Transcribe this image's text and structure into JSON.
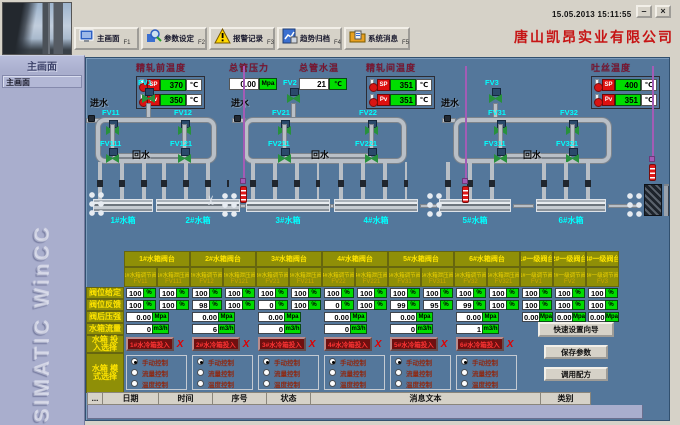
{
  "window": {
    "datetime": "15.05.2013 15:11:55",
    "company": "唐山凯昂实业有限公司",
    "minimize": "–",
    "close": "×"
  },
  "toolbar": {
    "buttons": [
      {
        "label": "主画面",
        "fkey": "F1"
      },
      {
        "label": "参数设定",
        "fkey": "F2"
      },
      {
        "label": "报警记录",
        "fkey": "F3"
      },
      {
        "label": "趋势归档",
        "fkey": "F4"
      },
      {
        "label": "系统消息",
        "fkey": "F5"
      }
    ]
  },
  "sidebar": {
    "title": "主画面",
    "nav_button": "主画面",
    "watermark": "SIMATIC WinCC"
  },
  "diagram": {
    "inlet_label": "进水",
    "return_label": "回水",
    "temp_panels": [
      {
        "title": "精轧前温度",
        "rows": [
          {
            "tag": "SP",
            "value": "370",
            "unit": "℃"
          },
          {
            "tag": "Pv",
            "value": "350",
            "unit": "℃"
          }
        ]
      },
      {
        "title": "总管压力",
        "rows": [
          {
            "value": "0.00",
            "unit": "Mpa"
          }
        ]
      },
      {
        "title": "总管水温",
        "rows": [
          {
            "value": "21",
            "unit": "℃"
          }
        ]
      },
      {
        "title": "精轧间温度",
        "rows": [
          {
            "tag": "SP",
            "value": "351",
            "unit": "℃"
          },
          {
            "tag": "Pv",
            "value": "351",
            "unit": "℃"
          }
        ]
      },
      {
        "title": "吐丝温度",
        "rows": [
          {
            "tag": "SP",
            "value": "400",
            "unit": "℃"
          },
          {
            "tag": "Pv",
            "value": "351",
            "unit": "℃"
          }
        ]
      }
    ],
    "sections": [
      {
        "main_valve": "FV1",
        "branch1": "FV11",
        "branch2": "FV12",
        "relief1": "FV111",
        "relief2": "FV121"
      },
      {
        "main_valve": "FV2",
        "branch1": "FV21",
        "branch2": "FV22",
        "relief1": "FV211",
        "relief2": "FV221"
      },
      {
        "main_valve": "FV3",
        "branch1": "FV31",
        "branch2": "FV32",
        "relief1": "FV311",
        "relief2": "FV321"
      }
    ],
    "tanks": [
      "1#水箱",
      "2#水箱",
      "3#水箱",
      "4#水箱",
      "5#水箱",
      "6#水箱"
    ]
  },
  "table": {
    "row_labels": [
      "阀位给定",
      "阀位反馈",
      "阀后压强",
      "水箱流量",
      "水箱 投入选择",
      "水箱 模式选择"
    ],
    "units": {
      "percent": "%",
      "pressure": "Mpa",
      "flow": "m3/h"
    },
    "x_mark": "X",
    "groups": [
      {
        "header": "1#水箱阀台",
        "cols": [
          {
            "name": "1#水箱调节阀",
            "tag": "FV11",
            "sp": "100",
            "fb": "100"
          },
          {
            "name": "1#水箱泄压阀",
            "tag": "FV111",
            "sp": "100",
            "fb": "100"
          }
        ],
        "pressure": "0.00",
        "flow": "0",
        "invest": "1#水冷箱投入"
      },
      {
        "header": "2#水箱阀台",
        "cols": [
          {
            "name": "2#水箱调节阀",
            "tag": "FV12",
            "sp": "100",
            "fb": "98"
          },
          {
            "name": "2#水箱泄压阀",
            "tag": "FV121",
            "sp": "100",
            "fb": "100"
          }
        ],
        "pressure": "0.00",
        "flow": "6",
        "invest": "2#水冷箱投入"
      },
      {
        "header": "3#水箱阀台",
        "cols": [
          {
            "name": "3#水箱调节阀",
            "tag": "FV21",
            "sp": "100",
            "fb": "0"
          },
          {
            "name": "3#水箱泄压阀",
            "tag": "FV211",
            "sp": "100",
            "fb": "100"
          }
        ],
        "pressure": "0.00",
        "flow": "0",
        "invest": "3#水冷箱投入"
      },
      {
        "header": "4#水箱阀台",
        "cols": [
          {
            "name": "4#水箱调节阀",
            "tag": "FV22",
            "sp": "100",
            "fb": "0"
          },
          {
            "name": "4#水箱泄压阀",
            "tag": "FV221",
            "sp": "100",
            "fb": "100"
          }
        ],
        "pressure": "0.00",
        "flow": "0",
        "invest": "4#水冷箱投入"
      },
      {
        "header": "5#水箱阀台",
        "cols": [
          {
            "name": "5#水箱调节阀",
            "tag": "FV31",
            "sp": "100",
            "fb": "99"
          },
          {
            "name": "5#水箱泄压阀",
            "tag": "FV311",
            "sp": "100",
            "fb": "95"
          }
        ],
        "pressure": "0.00",
        "flow": "0",
        "invest": "5#水冷箱投入"
      },
      {
        "header": "6#水箱阀台",
        "cols": [
          {
            "name": "6#水箱调节阀",
            "tag": "FV32",
            "sp": "100",
            "fb": "99"
          },
          {
            "name": "6#水箱泄压阀",
            "tag": "FV321",
            "sp": "100",
            "fb": "100"
          }
        ],
        "pressure": "0.00",
        "flow": "1",
        "invest": "6#水冷箱投入"
      }
    ],
    "singles": [
      {
        "header": "1#一级阀台",
        "name": "1#一级调节阀",
        "tag": "FV1",
        "sp": "100",
        "fb": "100",
        "pressure": "0.00"
      },
      {
        "header": "2#一级阀台",
        "name": "2#一级调节阀",
        "tag": "FV2",
        "sp": "100",
        "fb": "100",
        "pressure": "0.00"
      },
      {
        "header": "3#一级阀台",
        "name": "3#一级调节阀",
        "tag": "FV3",
        "sp": "100",
        "fb": "100",
        "pressure": "0.00"
      }
    ],
    "modes": [
      "手动控制",
      "流量控制",
      "温度控制"
    ],
    "selected_mode_index": 0
  },
  "side_buttons": [
    "快速设置向导",
    "保存参数",
    "调用配方"
  ],
  "alarm": {
    "more_button": "...",
    "columns": [
      "日期",
      "时间",
      "序号",
      "状态",
      "消息文本",
      "类别"
    ]
  }
}
